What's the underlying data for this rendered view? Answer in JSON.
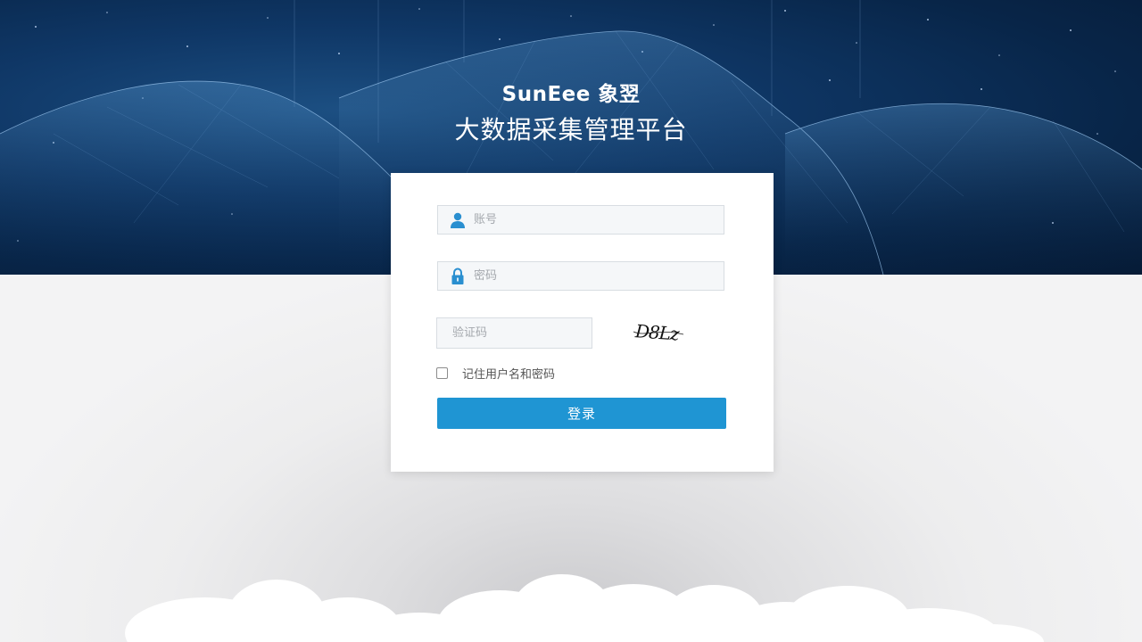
{
  "header": {
    "brand": "SunEee 象翌",
    "title": "大数据采集管理平台"
  },
  "login": {
    "account_placeholder": "账号",
    "password_placeholder": "密码",
    "captcha_placeholder": "验证码",
    "captcha_text": "D8Lz",
    "remember_label": "记住用户名和密码",
    "remember_checked": false,
    "submit_label": "登录"
  },
  "colors": {
    "primary": "#1f95d3",
    "icon": "#2a8fd0",
    "hero_dark": "#082548"
  },
  "icons": {
    "account": "user-icon",
    "password": "lock-icon"
  }
}
